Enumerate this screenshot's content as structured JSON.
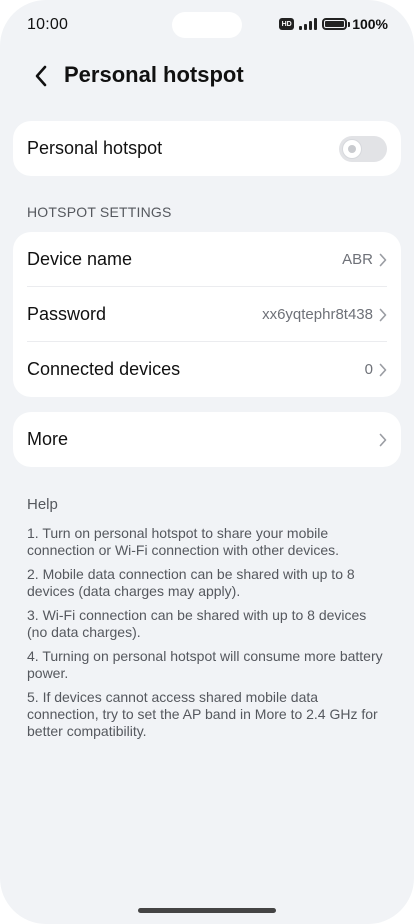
{
  "status_bar": {
    "time": "10:00",
    "hd": "HD",
    "battery": "100%"
  },
  "header": {
    "title": "Personal hotspot",
    "back_icon": "chevron-left-icon"
  },
  "hotspot": {
    "label": "Personal hotspot",
    "enabled": false
  },
  "settings": {
    "section_title": "HOTSPOT SETTINGS",
    "items": [
      {
        "label": "Device name",
        "value": "ABR"
      },
      {
        "label": "Password",
        "value": "xx6yqtephr8t438"
      },
      {
        "label": "Connected devices",
        "value": "0"
      }
    ]
  },
  "more": {
    "label": "More"
  },
  "help": {
    "title": "Help",
    "items": [
      "1. Turn on personal hotspot to share your mobile connection or Wi-Fi connection with other devices.",
      "2. Mobile data connection can be shared with up to 8 devices (data charges may apply).",
      "3. Wi-Fi connection can be shared with up to 8 devices (no data charges).",
      "4. Turning on personal hotspot will consume more battery power.",
      "5. If devices cannot access shared mobile data connection, try to set the AP band in More to 2.4 GHz for better compatibility."
    ]
  },
  "colors": {
    "background": "#f1f3f6",
    "card": "#ffffff",
    "secondary_text": "#6e7178",
    "toggle_off": "#e2e3e6"
  }
}
